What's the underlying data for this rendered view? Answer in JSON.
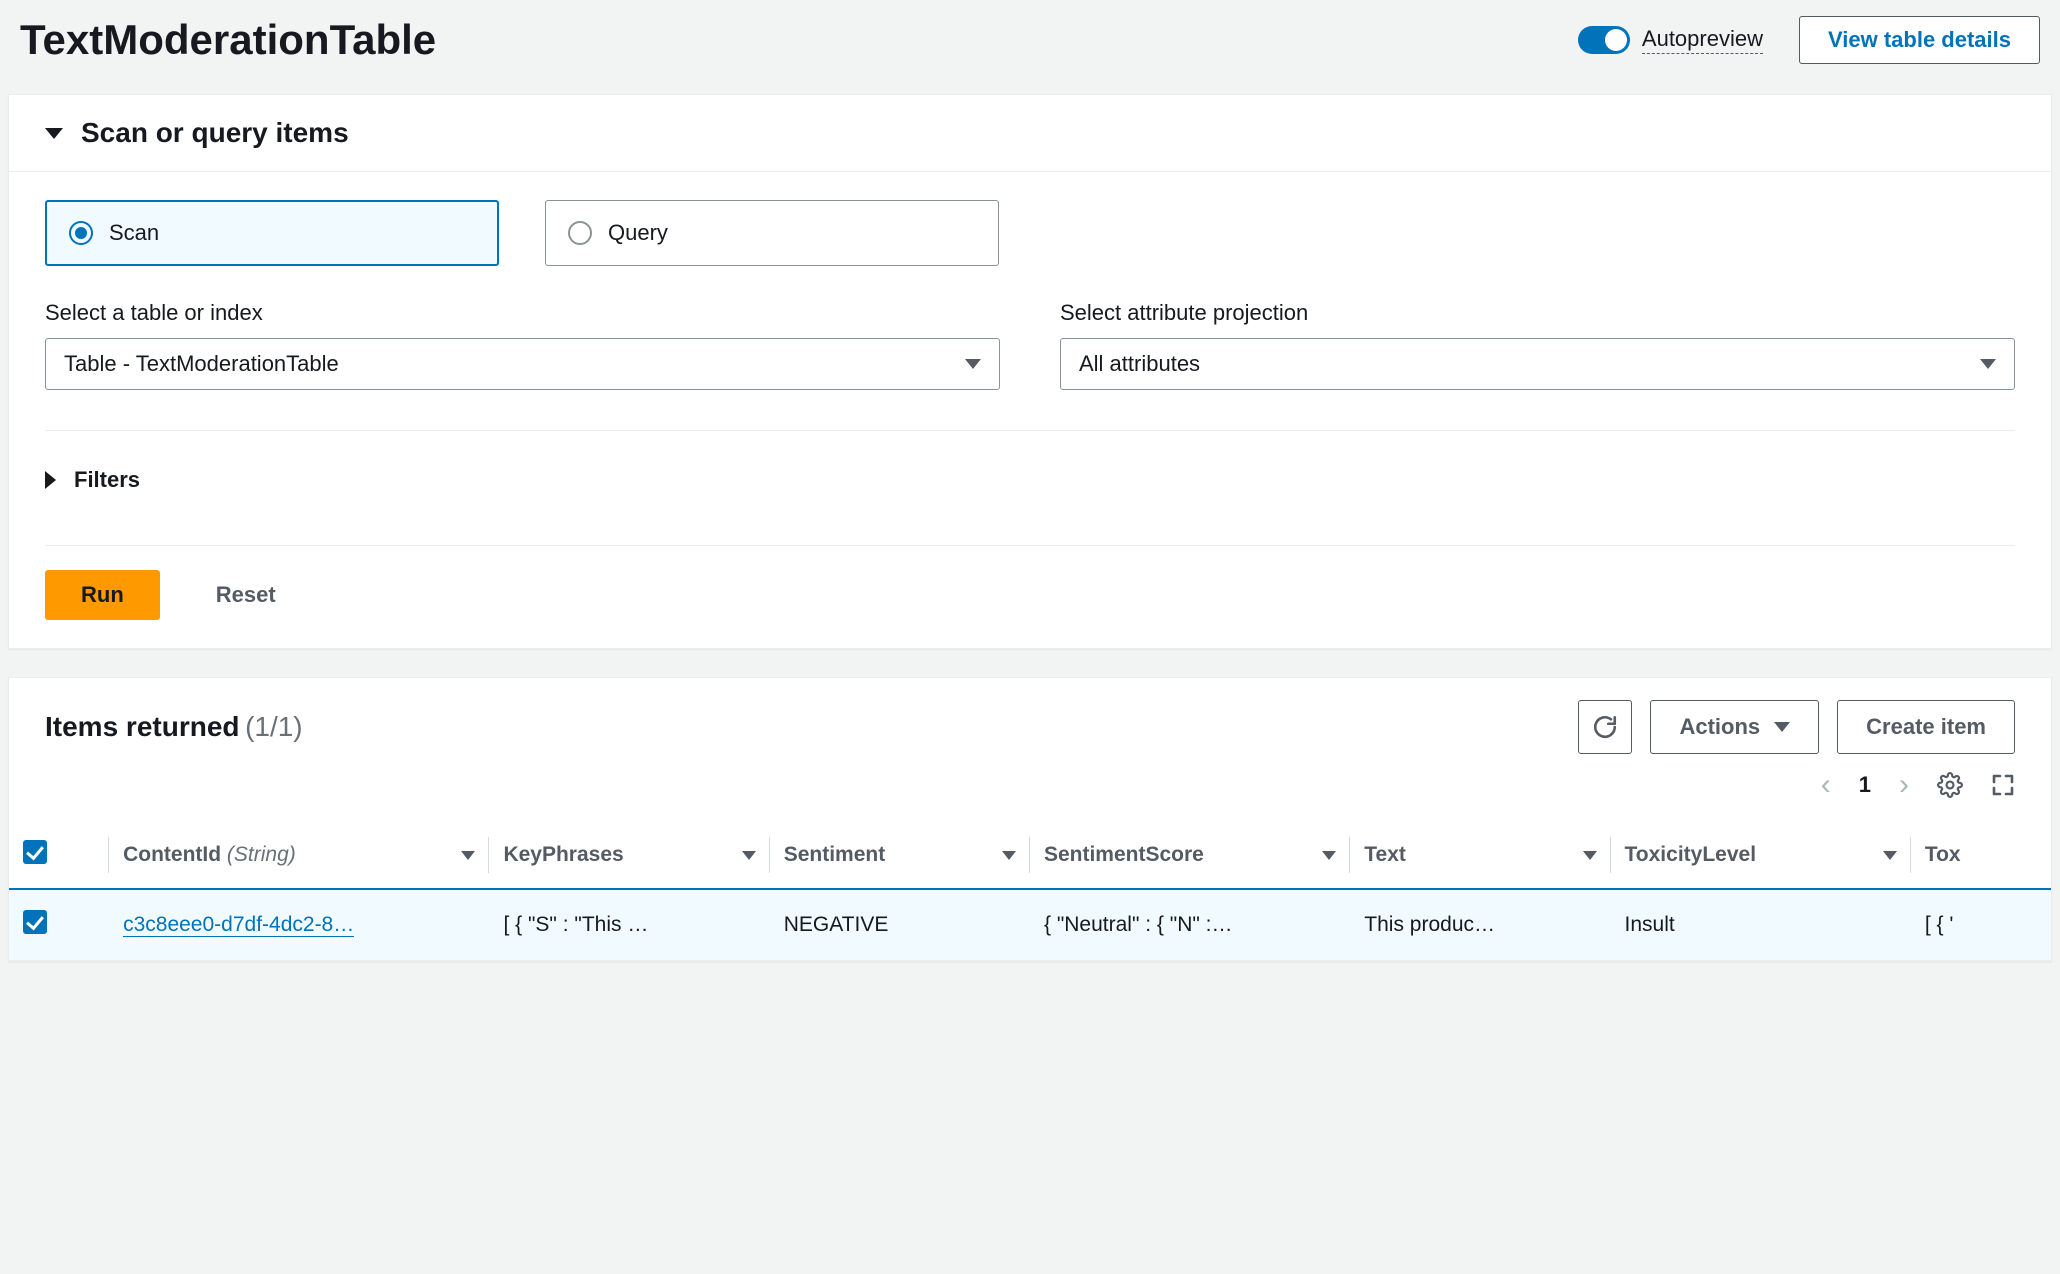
{
  "header": {
    "title": "TextModerationTable",
    "autopreview_label": "Autopreview",
    "view_details_label": "View table details"
  },
  "scan_panel": {
    "title": "Scan or query items",
    "radio": {
      "scan": "Scan",
      "query": "Query"
    },
    "table_select": {
      "label": "Select a table or index",
      "value": "Table - TextModerationTable"
    },
    "projection_select": {
      "label": "Select attribute projection",
      "value": "All attributes"
    },
    "filters_label": "Filters",
    "run_label": "Run",
    "reset_label": "Reset"
  },
  "results": {
    "title": "Items returned",
    "count": "(1/1)",
    "actions_label": "Actions",
    "create_label": "Create item",
    "page": "1",
    "columns": {
      "contentid": "ContentId",
      "contentid_type": "(String)",
      "keyphrases": "KeyPhrases",
      "sentiment": "Sentiment",
      "sentimentscore": "SentimentScore",
      "text": "Text",
      "toxicitylevel": "ToxicityLevel",
      "tox_trunc": "Tox"
    },
    "rows": [
      {
        "contentid": "c3c8eee0-d7df-4dc2-8…",
        "keyphrases": "[ { \"S\" : \"This …",
        "sentiment": "NEGATIVE",
        "sentimentscore": "{ \"Neutral\" : { \"N\" :…",
        "text": "This produc…",
        "toxicitylevel": "Insult",
        "toxtrunc": "[ { '"
      }
    ]
  }
}
